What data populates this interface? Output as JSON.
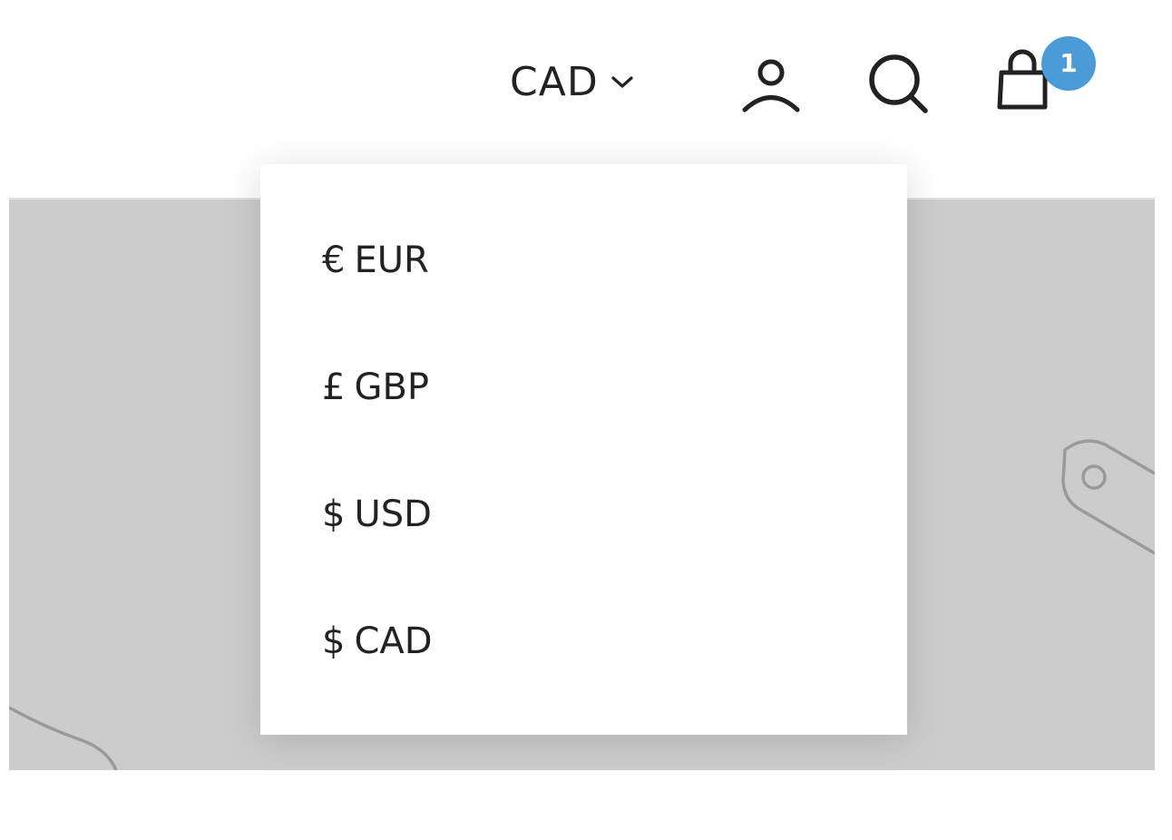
{
  "header": {
    "currency_selected": "CAD",
    "cart_count": "1",
    "icons": {
      "chevron": "chevron-down-icon",
      "account": "account-icon",
      "search": "search-icon",
      "cart": "shopping-bag-icon"
    }
  },
  "currency_menu": {
    "options": [
      {
        "symbol": "€",
        "code": "EUR"
      },
      {
        "symbol": "£",
        "code": "GBP"
      },
      {
        "symbol": "$",
        "code": "USD"
      },
      {
        "symbol": "$",
        "code": "CAD"
      }
    ]
  },
  "hero": {
    "decorative_icon": "price-tag-icon"
  },
  "colors": {
    "badge": "#4a9bd8",
    "hero_placeholder": "#cccccc",
    "text": "#222222"
  }
}
